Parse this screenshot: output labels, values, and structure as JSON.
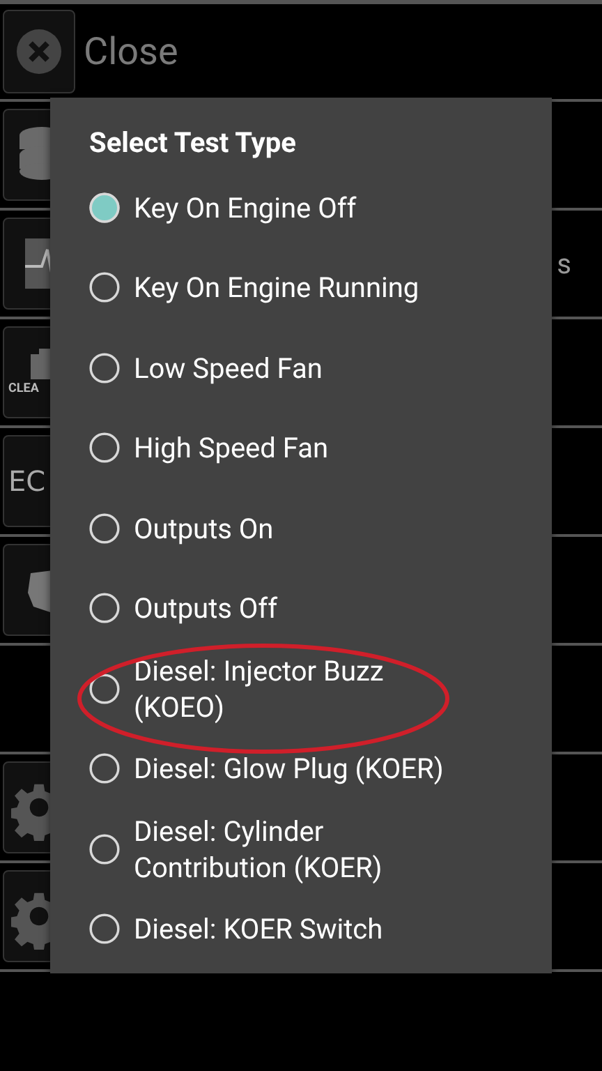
{
  "header": {
    "title": "Close"
  },
  "background_rows": [
    {
      "kind": "database"
    },
    {
      "kind": "waveform",
      "trailing_text": "s"
    },
    {
      "kind": "engine",
      "icon_text": "CLEA"
    },
    {
      "kind": "ec",
      "icon_text": "EC"
    },
    {
      "kind": "puzzle"
    },
    {
      "kind": "blank"
    },
    {
      "kind": "gear"
    },
    {
      "kind": "gear"
    }
  ],
  "dialog": {
    "title": "Select Test Type",
    "options": [
      {
        "label": "Key On Engine Off",
        "selected": true,
        "highlighted": false
      },
      {
        "label": "Key On Engine Running",
        "selected": false,
        "highlighted": false
      },
      {
        "label": "Low Speed Fan",
        "selected": false,
        "highlighted": false
      },
      {
        "label": "High Speed Fan",
        "selected": false,
        "highlighted": false
      },
      {
        "label": "Outputs On",
        "selected": false,
        "highlighted": false
      },
      {
        "label": "Outputs Off",
        "selected": false,
        "highlighted": false
      },
      {
        "label": "Diesel: Injector Buzz (KOEO)",
        "selected": false,
        "highlighted": true
      },
      {
        "label": "Diesel: Glow Plug (KOER)",
        "selected": false,
        "highlighted": false
      },
      {
        "label": "Diesel: Cylinder Contribution (KOER)",
        "selected": false,
        "highlighted": false
      },
      {
        "label": "Diesel: KOER Switch",
        "selected": false,
        "highlighted": false
      }
    ]
  }
}
